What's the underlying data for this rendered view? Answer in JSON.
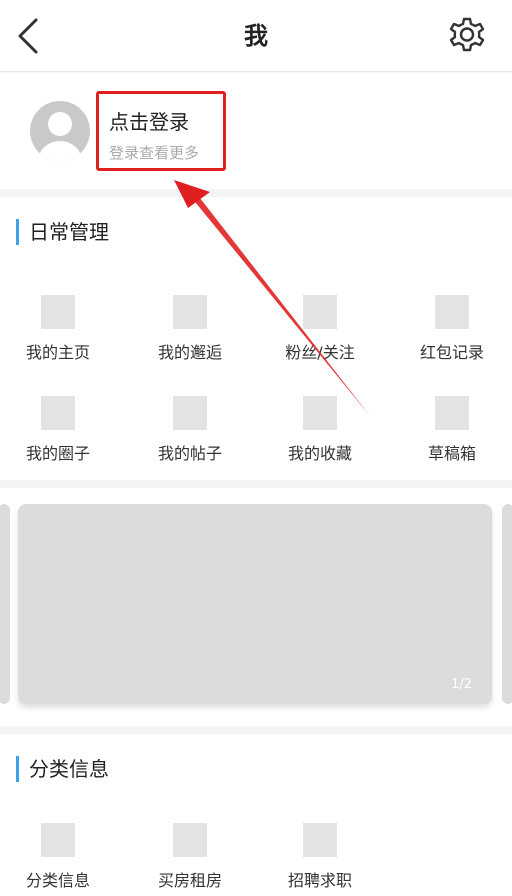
{
  "header": {
    "title": "我",
    "back_icon": "chevron-left-icon",
    "settings_icon": "gear-icon"
  },
  "profile": {
    "avatar_icon": "user-avatar-icon",
    "login_title": "点击登录",
    "login_subtitle": "登录查看更多",
    "highlight_color": "#e02020"
  },
  "daily": {
    "title": "日常管理",
    "items": [
      {
        "label": "我的主页"
      },
      {
        "label": "我的邂逅"
      },
      {
        "label": "粉丝/关注"
      },
      {
        "label": "红包记录"
      },
      {
        "label": "我的圈子"
      },
      {
        "label": "我的帖子"
      },
      {
        "label": "我的收藏"
      },
      {
        "label": "草稿箱"
      }
    ]
  },
  "banner": {
    "pager": "1/2"
  },
  "category": {
    "title": "分类信息",
    "items": [
      {
        "label": "分类信息"
      },
      {
        "label": "买房租房"
      },
      {
        "label": "招聘求职"
      }
    ]
  },
  "colors": {
    "accent": "#3ba3e6",
    "annotation": "#e02020"
  }
}
